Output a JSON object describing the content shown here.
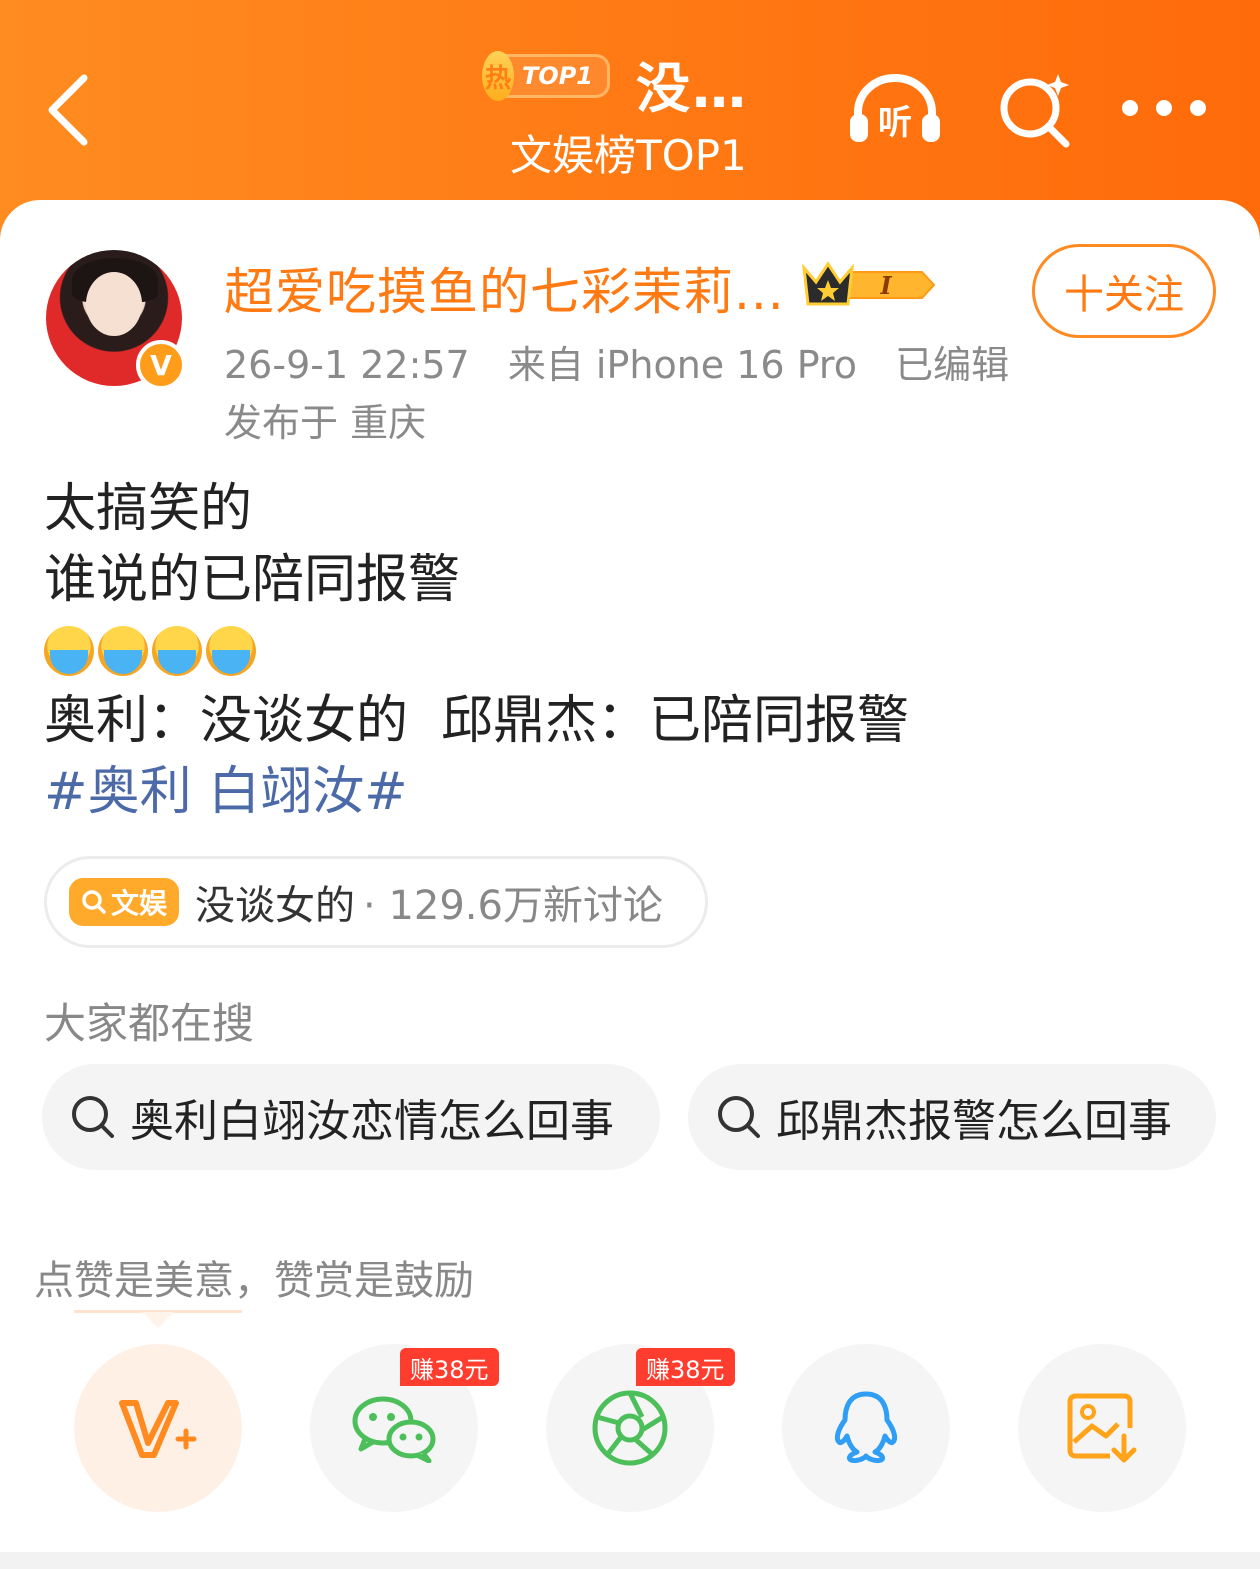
{
  "header": {
    "hot_badge": "热",
    "top_tag": "TOP1",
    "title": "没…",
    "subtitle": "文娱榜TOP1",
    "listen_label": "听"
  },
  "post": {
    "username": "超爱吃摸鱼的七彩茉莉...",
    "level_badge": "I",
    "verified_mark": "V",
    "follow_label": "十关注",
    "time": "26-9-1 22:57",
    "source": "来自 iPhone 16 Pro",
    "edited": "已编辑",
    "location": "发布于 重庆",
    "lines": [
      "太搞笑的",
      "谁说的已陪同报警"
    ],
    "quote_line": "奥利：没谈女的  邱鼎杰：已陪同报警",
    "hashtag": "#奥利 白翊汝#",
    "emoji_count": 4
  },
  "topic": {
    "tag_label": "文娱",
    "text": "没谈女的",
    "count": "· 129.6万新讨论"
  },
  "searches": {
    "label": "大家都在搜",
    "items": [
      "奥利白翊汝恋情怎么回事",
      "邱鼎杰报警怎么回事"
    ]
  },
  "reward": {
    "label": "点赞是美意，赞赏是鼓励"
  },
  "share": {
    "earn_wechat": "赚38元",
    "earn_moments": "赚38元",
    "icons": [
      "vplus-icon",
      "wechat-icon",
      "moments-icon",
      "qq-icon",
      "save-image-icon"
    ]
  },
  "colors": {
    "brand_orange": "#ff7a12",
    "hashtag_blue": "#4d6aa8",
    "earn_red": "#ff3d2e"
  }
}
